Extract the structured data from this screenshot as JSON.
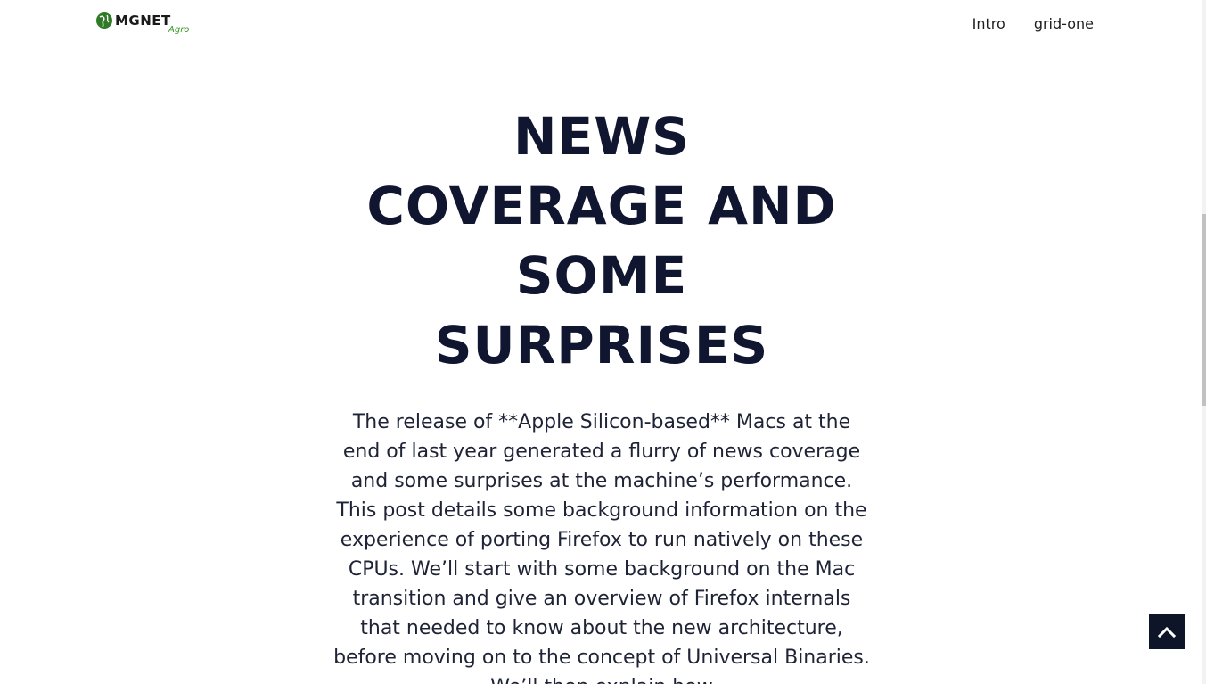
{
  "brand": {
    "name": "MGNET",
    "tagline": "Agro",
    "accent_color": "#3a9a2a"
  },
  "nav": {
    "items": [
      {
        "label": "Intro"
      },
      {
        "label": "grid-one"
      }
    ]
  },
  "hero": {
    "title_lines": [
      "NEWS",
      "COVERAGE AND",
      "SOME",
      "SURPRISES"
    ],
    "body": "The release of **Apple Silicon-based** Macs at the end of last year generated a flurry of news coverage and some surprises at the machine’s performance. This post details some background information on the experience of porting Firefox to run natively on these CPUs. We’ll start with some background on the Mac transition and give an overview of Firefox internals that needed to know about the new architecture, before moving on to the concept of Universal Binaries. We’ll then explain how"
  },
  "back_to_top": {
    "icon": "chevron-up-icon",
    "background": "#0f1528"
  }
}
